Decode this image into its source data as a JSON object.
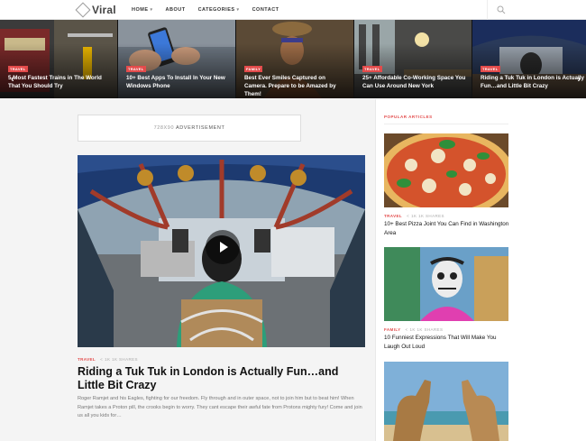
{
  "header": {
    "logo": "Viral",
    "nav": [
      {
        "label": "HOME",
        "caret": true
      },
      {
        "label": "ABOUT",
        "caret": false
      },
      {
        "label": "CATEGORIES",
        "caret": true
      },
      {
        "label": "CONTACT",
        "caret": false
      }
    ]
  },
  "slider": {
    "slides": [
      {
        "tag": "TRAVEL",
        "title": "5 Most Fastest Trains in The World That You Should Try"
      },
      {
        "tag": "TRAVEL",
        "title": "10+ Best Apps To Install In Your New Windows Phone"
      },
      {
        "tag": "FAMILY",
        "title": "Best Ever Smiles Captured on Camera. Prepare to be Amazed by Them!"
      },
      {
        "tag": "TRAVEL",
        "title": "25+ Affordable Co-Working Space You Can Use Around New York"
      },
      {
        "tag": "TRAVEL",
        "title": "Riding a Tuk Tuk in London is Actually Fun…and Little Bit Crazy"
      }
    ]
  },
  "ad": {
    "size": "728X90",
    "label": "ADVERTISEMENT"
  },
  "main_article": {
    "category": "TRAVEL",
    "shares": "1K 1K SHARES",
    "title": "Riding a Tuk Tuk in London is Actually Fun…and Little Bit Crazy",
    "excerpt": "Roger Ramjet and his Eagles, fighting for our freedom. Fly through and in outer space, not to join him but to beat him! When Ramjet takes a Proton pill, the crooks begin to worry. They cant escape their awful fate from Protons mighty fury! Come and join us all you kids for…"
  },
  "sidebar": {
    "heading": "POPULAR ARTICLES",
    "items": [
      {
        "category": "TRAVEL",
        "shares": "1K 1K SHARES",
        "title": "10+ Best Pizza Joint You Can Find in Washington Area"
      },
      {
        "category": "FAMILY",
        "shares": "1K 1K SHARES",
        "title": "10 Funniest Expressions That Will Make You Laugh Out Loud"
      },
      {
        "category": "",
        "shares": "",
        "title": ""
      }
    ]
  },
  "colors": {
    "accent": "#e34b4b"
  }
}
